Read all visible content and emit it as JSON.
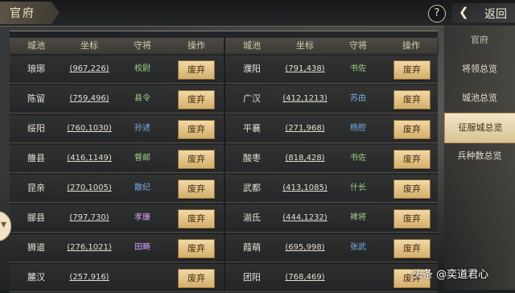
{
  "header": {
    "title": "官府",
    "help_label": "?",
    "back_label": "返回"
  },
  "table": {
    "columns": [
      "城池",
      "坐标",
      "守将",
      "操作"
    ],
    "rows": [
      {
        "left": {
          "city": "琅琊",
          "coord": "(967,226)",
          "guard": "校尉",
          "guard_color": "#9ed08a",
          "action": "废弃"
        },
        "right": {
          "city": "濮阳",
          "coord": "(791,438)",
          "guard": "书佐",
          "guard_color": "#9ed08a",
          "action": "废弃"
        }
      },
      {
        "left": {
          "city": "陈留",
          "coord": "(759,496)",
          "guard": "县令",
          "guard_color": "#9ed08a",
          "action": "废弃"
        },
        "right": {
          "city": "广汉",
          "coord": "(412,1213)",
          "guard": "苏由",
          "guard_color": "#7ab0e6",
          "action": "废弃"
        }
      },
      {
        "left": {
          "city": "绥阳",
          "coord": "(760,1030)",
          "guard": "孙述",
          "guard_color": "#7ab0e6",
          "action": "废弃"
        },
        "right": {
          "city": "平襄",
          "coord": "(271,968)",
          "guard": "杨腔",
          "guard_color": "#7ab0e6",
          "action": "废弃"
        }
      },
      {
        "left": {
          "city": "雒县",
          "coord": "(416,1149)",
          "guard": "督邮",
          "guard_color": "#9ed08a",
          "action": "废弃"
        },
        "right": {
          "city": "酸枣",
          "coord": "(818,428)",
          "guard": "书佐",
          "guard_color": "#9ed08a",
          "action": "废弃"
        }
      },
      {
        "left": {
          "city": "昆亲",
          "coord": "(270,1005)",
          "guard": "散纪",
          "guard_color": "#7ab0e6",
          "action": "废弃"
        },
        "right": {
          "city": "武都",
          "coord": "(413,1085)",
          "guard": "什长",
          "guard_color": "#9ed08a",
          "action": "废弃"
        }
      },
      {
        "left": {
          "city": "郦县",
          "coord": "(797,730)",
          "guard": "孝廉",
          "guard_color": "#d6a2ff",
          "action": "废弃"
        },
        "right": {
          "city": "湔氐",
          "coord": "(444,1232)",
          "guard": "裨将",
          "guard_color": "#9ed08a",
          "action": "废弃"
        }
      },
      {
        "left": {
          "city": "狮道",
          "coord": "(276,1021)",
          "guard": "田畴",
          "guard_color": "#d6a2ff",
          "action": "废弃"
        },
        "right": {
          "city": "葭萌",
          "coord": "(695,998)",
          "guard": "张武",
          "guard_color": "#7ab0e6",
          "action": "废弃"
        }
      },
      {
        "left": {
          "city": "麓汉",
          "coord": "(257,916)",
          "guard": "",
          "guard_color": "#9ed08a",
          "action": "废弃"
        },
        "right": {
          "city": "团阳",
          "coord": "(768,469)",
          "guard": "",
          "guard_color": "#9ed08a",
          "action": "废弃"
        }
      }
    ]
  },
  "sidebar": {
    "items": [
      {
        "label": "官府",
        "state": "dim"
      },
      {
        "label": "将领总览",
        "state": "normal"
      },
      {
        "label": "城池总览",
        "state": "normal"
      },
      {
        "label": "征服城总览",
        "state": "active"
      },
      {
        "label": "兵种数总览",
        "state": "normal"
      }
    ]
  },
  "watermark": "头条 @奕道君心"
}
